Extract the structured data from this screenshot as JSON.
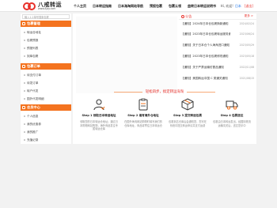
{
  "header": {
    "logo_name": "八戒转运",
    "logo_domain": "www.8jzy.com",
    "nav": [
      "个人主页",
      "日本转运指南",
      "日本海淘网站导航",
      "预报包裹",
      "包裹认领",
      "益转日本转运说明书"
    ],
    "greeting": "Hi, 欢迎!",
    "user_name": "日本",
    "logout": "[退出]"
  },
  "sidebar": {
    "search_placeholder": "输入1-2单号搜索包裹",
    "groups": [
      {
        "title": "包裹管理",
        "items": [
          "转运仓地址",
          "包裹预报",
          "预报列表",
          "到库包裹"
        ]
      },
      {
        "title": "包裹订单",
        "items": [
          "待支付订单",
          "待发订单",
          "转户代发",
          "国外代发明细"
        ]
      },
      {
        "title": "会员中心",
        "items": [
          "个人信息",
          "我的优惠券",
          "我的推广",
          "充值记录"
        ]
      }
    ]
  },
  "notice": {
    "title": "公告",
    "more": "更多 >",
    "items": [
      {
        "title": "【通知】2024年日本仓包裹换新通知",
        "date": "2024/02/24"
      },
      {
        "title": "【通知】2023年日本仓包裹转运服务通知",
        "date": "2023/06/24"
      },
      {
        "title": "【通知】关于日本仓个人海淘进口通知",
        "date": "2023/05/29"
      },
      {
        "title": "【通知】2023年日本仓包裹修改通知",
        "date": "2023/05/18"
      },
      {
        "title": "【通知】关于严禁运输仿冒品通知",
        "date": "2022/11/08"
      },
      {
        "title": "【通知】美国转运中国 C 类通关通知",
        "date": "2021/08/15"
      }
    ]
  },
  "tagline": "轻松四步，搞定转运海淘",
  "steps": [
    {
      "title": "Step 1 领取日本转运地址",
      "desc": "领取您的日本转运仓地址；通过日本购物网站购物，海外商品发往专属转运仓库"
    },
    {
      "title": "Step 2 填写海外仓地址",
      "desc": "在国外海淘网站购物时填写我们的仓库地址，商品将寄往日本转运仓"
    },
    {
      "title": "Step 3 提交转运包裹",
      "desc": "包裹到达仓库后会通知您，您可在系统中提交转运申请并支付运费"
    },
    {
      "title": "Step 4 包裹送达",
      "desc": "包裹由日本转运发出，经国际物流运输清关后，送达您手中"
    }
  ],
  "colors": {
    "accent": "#f4731f",
    "brand_red": "#e8312b",
    "link_blue": "#1a73e8"
  }
}
